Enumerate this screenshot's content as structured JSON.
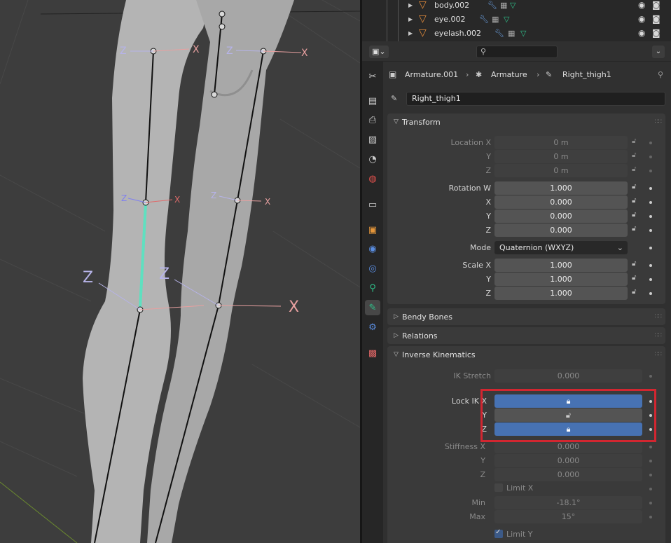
{
  "outliner": {
    "rows": [
      {
        "name": "body.002"
      },
      {
        "name": "eye.002"
      },
      {
        "name": "eyelash.002"
      }
    ]
  },
  "breadcrumb": {
    "object": "Armature.001",
    "data": "Armature",
    "bone": "Right_thigh1"
  },
  "bone_name": "Right_thigh1",
  "transform": {
    "title": "Transform",
    "location_label": "Location X",
    "y_label": "Y",
    "z_label": "Z",
    "x_label": "X",
    "location": [
      "0 m",
      "0 m",
      "0 m"
    ],
    "rotation_label": "Rotation W",
    "rotation": [
      "1.000",
      "0.000",
      "0.000",
      "0.000"
    ],
    "mode_label": "Mode",
    "mode_value": "Quaternion (WXYZ)",
    "scale_label": "Scale X",
    "scale": [
      "1.000",
      "1.000",
      "1.000"
    ]
  },
  "panels": {
    "bendy": "Bendy Bones",
    "relations": "Relations",
    "ik": "Inverse Kinematics"
  },
  "ik": {
    "stretch_label": "IK Stretch",
    "stretch_value": "0.000",
    "lock_label": "Lock IK X",
    "lock_y_label": "Y",
    "lock_z_label": "Z",
    "lock_x_on": true,
    "lock_y_on": false,
    "lock_z_on": true,
    "stiffness_label": "Stiffness X",
    "stiff_y_label": "Y",
    "stiff_z_label": "Z",
    "stiffness": [
      "0.000",
      "0.000",
      "0.000"
    ],
    "limit_x_label": "Limit X",
    "min_label": "Min",
    "max_label": "Max",
    "min_value": "-18.1°",
    "max_value": "15°",
    "limit_y_label": "Limit Y"
  },
  "viewport_axes": [
    "Z",
    "X",
    "Z",
    "X",
    "Z",
    "X",
    "Z",
    "X",
    "Z",
    "Z",
    "X"
  ],
  "colors": {
    "accent_blue": "#4772b3",
    "highlight_red": "#d22630",
    "active_bone": "#5fe0c0"
  }
}
